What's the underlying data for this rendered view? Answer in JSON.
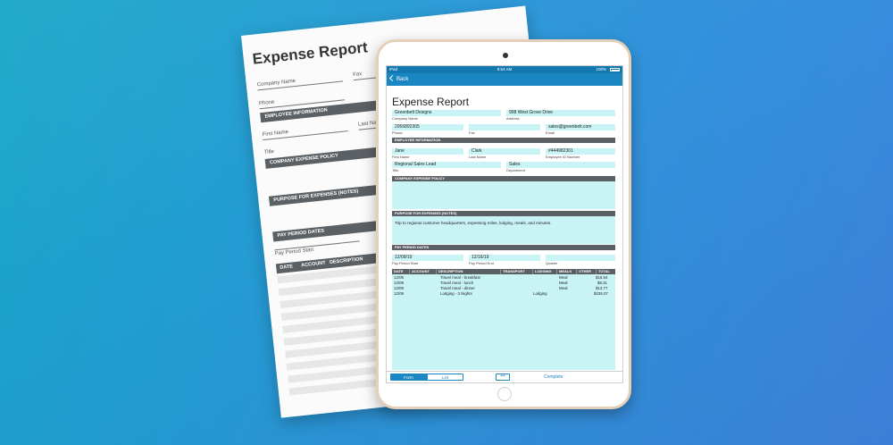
{
  "paper_form": {
    "title": "Expense Report",
    "labels": {
      "company_name": "Company Name",
      "phone": "Phone",
      "fax": "Fax",
      "first_name": "First Name",
      "last_name": "Last Name",
      "title": "Title",
      "pay_period_start": "Pay Period Start"
    },
    "sections": {
      "employee_info": "EMPLOYEE INFORMATION",
      "expense_policy": "COMPANY EXPENSE POLICY",
      "purpose": "PURPOSE FOR EXPENSES (NOTES)",
      "pay_period": "PAY PERIOD DATES"
    },
    "table_headers": [
      "DATE",
      "ACCOUNT",
      "DESCRIPTION"
    ]
  },
  "ipad": {
    "status_bar": {
      "carrier": "iPad",
      "time": "8:54 AM",
      "battery": "100%"
    },
    "nav": {
      "back_label": "Back"
    },
    "form": {
      "title": "Expense Report",
      "company_name": {
        "value": "Greenbelt Designs",
        "label": "Company Name"
      },
      "address": {
        "value": "998 West Grove Drive",
        "label": "Address"
      },
      "phone": {
        "value": "2056892305",
        "label": "Phone"
      },
      "fax": {
        "value": "",
        "label": "Fax"
      },
      "email": {
        "value": "sales@greenbelt.com",
        "label": "Email"
      },
      "employee_section": "EMPLOYEE INFORMATION",
      "first_name": {
        "value": "Jane",
        "label": "First Name"
      },
      "last_name": {
        "value": "Clark",
        "label": "Last Name"
      },
      "employee_id": {
        "value": "#444982301",
        "label": "Employee ID Number"
      },
      "title_field": {
        "value": "Regional Sales Lead",
        "label": "Title"
      },
      "department": {
        "value": "Sales",
        "label": "Department"
      },
      "policy_section": "COMPANY EXPENSE POLICY",
      "purpose_section": "PURPOSE FOR EXPENSES (NOTES)",
      "purpose_text": "Trip to regional customer headquarters, expensing miles, lodging, meals, and minutes.",
      "pay_period_section": "PAY PERIOD DATES",
      "pay_period_start": {
        "value": "12/09/19",
        "label": "Pay Period Start"
      },
      "pay_period_end": {
        "value": "12/16/19",
        "label": "Pay Period End"
      },
      "quarter": {
        "value": "",
        "label": "Quarter"
      },
      "table": {
        "headers": [
          "DATE",
          "ACCOUNT",
          "DESCRIPTION",
          "TRANSPORT",
          "LODGING",
          "MEALS",
          "OTHER",
          "TOTAL"
        ],
        "rows": [
          {
            "date": "12/09",
            "description": "Travel meal - breakfast",
            "lodging": "",
            "meals": "Meal",
            "total": "$16.54"
          },
          {
            "date": "12/09",
            "description": "Travel meal - lunch",
            "lodging": "",
            "meals": "Meal",
            "total": "$9.31"
          },
          {
            "date": "12/09",
            "description": "Travel meal - dinner",
            "lodging": "",
            "meals": "Meal",
            "total": "$13.77"
          },
          {
            "date": "12/09",
            "description": "Lodging - 3 Nights",
            "lodging": "Lodging",
            "meals": "",
            "total": "$235.07"
          }
        ]
      }
    },
    "bottom_bar": {
      "form_tab": "Form",
      "list_tab": "List",
      "more": "•••",
      "complete": "Complete"
    }
  }
}
